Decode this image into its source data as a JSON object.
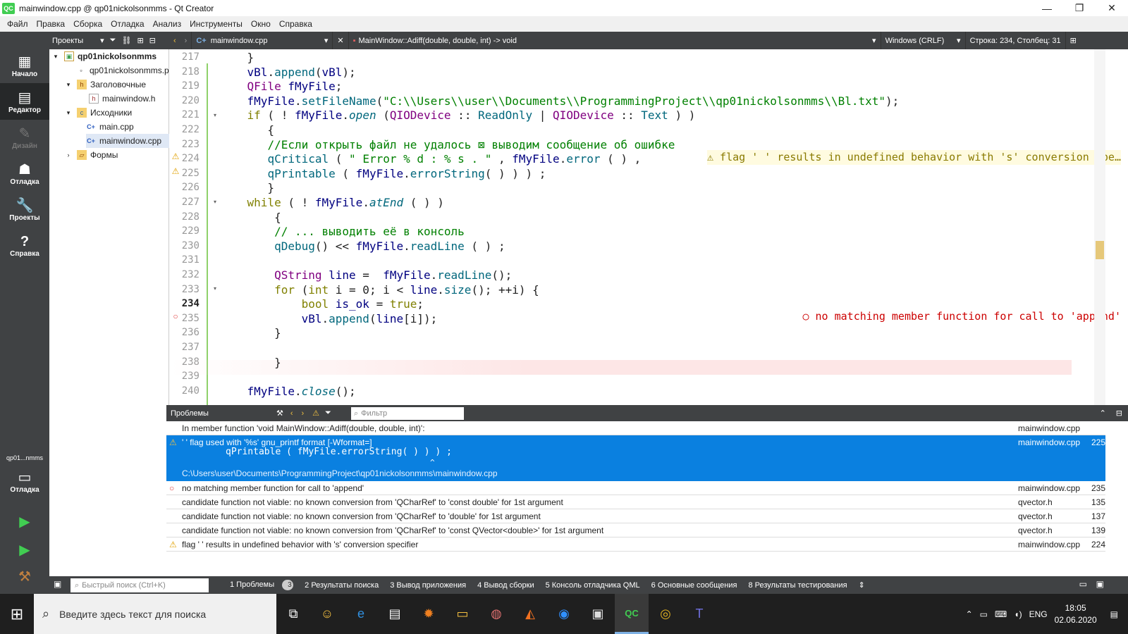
{
  "window": {
    "title": "mainwindow.cpp @ qp01nickolsonmms - Qt Creator",
    "logo": "QC"
  },
  "menu": [
    "Файл",
    "Правка",
    "Сборка",
    "Отладка",
    "Анализ",
    "Инструменты",
    "Окно",
    "Справка"
  ],
  "modes": [
    {
      "label": "Начало",
      "icon": "▦"
    },
    {
      "label": "Редактор",
      "icon": "▤"
    },
    {
      "label": "Дизайн",
      "icon": "✎"
    },
    {
      "label": "Отладка",
      "icon": "☗"
    },
    {
      "label": "Проекты",
      "icon": "🔧"
    },
    {
      "label": "Справка",
      "icon": "?"
    }
  ],
  "mode_project": {
    "label": "qp01...nmms",
    "run_label": "Отладка"
  },
  "proj_toolbar": {
    "label": "Проекты"
  },
  "editor_toolbar": {
    "file": "mainwindow.cpp",
    "symbol": "MainWindow::Adiff(double, double, int) -> void",
    "encoding": "Windows (CRLF)",
    "position": "Строка: 234, Столбец: 31"
  },
  "tree": [
    {
      "label": "qp01nickolsonmms",
      "arrow": "▾",
      "icon": "▣"
    },
    {
      "label": "qp01nickolsonmms.pro",
      "arrow": "",
      "icon": "▫"
    },
    {
      "label": "Заголовочные",
      "arrow": "▾",
      "icon": "h"
    },
    {
      "label": "mainwindow.h",
      "arrow": "",
      "icon": "h"
    },
    {
      "label": "Исходники",
      "arrow": "▾",
      "icon": "c"
    },
    {
      "label": "main.cpp",
      "arrow": "",
      "icon": "C+"
    },
    {
      "label": "mainwindow.cpp",
      "arrow": "",
      "icon": "C+"
    },
    {
      "label": "Формы",
      "arrow": "›",
      "icon": "▱"
    }
  ],
  "code_lines": [
    {
      "n": "217",
      "html": "    }"
    },
    {
      "n": "218",
      "html": "    vBl.append(vBl);"
    },
    {
      "n": "219",
      "html": "    QFile fMyFile;"
    },
    {
      "n": "220",
      "html": "    fMyFile.setFileName(\"C:\\\\Users\\\\user\\\\Documents\\\\ProgrammingProject\\\\qp01nickolsonmms\\\\Bl.txt\");"
    },
    {
      "n": "221",
      "html": "    if ( ! fMyFile.open (QIODevice :: ReadOnly | QIODevice :: Text ) )"
    },
    {
      "n": "222",
      "html": "       {"
    },
    {
      "n": "223",
      "html": "       //Если открыть файл не удалось ⊠ выводим сообщение об ошибке"
    },
    {
      "n": "224",
      "html": "       qCritical ( \" Error % d : % s . \" , fMyFile.error ( ) ,"
    },
    {
      "n": "225",
      "html": "       qPrintable ( fMyFile.errorString( ) ) ) ;"
    },
    {
      "n": "226",
      "html": "       }"
    },
    {
      "n": "227",
      "html": "    while ( ! fMyFile.atEnd ( ) )"
    },
    {
      "n": "228",
      "html": "        {"
    },
    {
      "n": "229",
      "html": "        // ... выводить её в консоль"
    },
    {
      "n": "230",
      "html": "        qDebug() << fMyFile.readLine ( ) ;"
    },
    {
      "n": "231",
      "html": ""
    },
    {
      "n": "232",
      "html": "        QString line =  fMyFile.readLine();"
    },
    {
      "n": "233",
      "html": "        for (int i = 0; i < line.size(); ++i) {"
    },
    {
      "n": "234",
      "html": "            bool is_ok = true;"
    },
    {
      "n": "235",
      "html": "            vBl.append(line[i]);"
    },
    {
      "n": "236",
      "html": "        }"
    },
    {
      "n": "237",
      "html": ""
    },
    {
      "n": "238",
      "html": "        }"
    },
    {
      "n": "239",
      "html": ""
    },
    {
      "n": "240",
      "html": "    fMyFile.close();"
    }
  ],
  "annotations": {
    "warn": "flag ' ' results in undefined behavior with 's' conversion spe…",
    "err": "no matching member function for call to 'append'"
  },
  "problems": {
    "title": "Проблемы",
    "filter_placeholder": "Фильтр",
    "rows": [
      {
        "icon": "",
        "text": "In member function 'void MainWindow::Adiff(double, double, int)':",
        "file": "mainwindow.cpp",
        "line": ""
      },
      {
        "icon": "⚠",
        "text": "' ' flag used with '%s' gnu_printf format [-Wformat=]",
        "file": "mainwindow.cpp",
        "line": "225",
        "code": "qPrintable ( fMyFile.errorString( ) ) ) ;",
        "caret": "^",
        "path": "C:\\Users\\user\\Documents\\ProgrammingProject\\qp01nickolsonmms\\mainwindow.cpp"
      },
      {
        "icon": "○",
        "text": "no matching member function for call to 'append'",
        "file": "mainwindow.cpp",
        "line": "235"
      },
      {
        "icon": "",
        "text": "candidate function not viable: no known conversion from 'QCharRef' to 'const double' for 1st argument",
        "file": "qvector.h",
        "line": "135"
      },
      {
        "icon": "",
        "text": "candidate function not viable: no known conversion from 'QCharRef' to 'double' for 1st argument",
        "file": "qvector.h",
        "line": "137"
      },
      {
        "icon": "",
        "text": "candidate function not viable: no known conversion from 'QCharRef' to 'const QVector<double>' for 1st argument",
        "file": "qvector.h",
        "line": "139"
      },
      {
        "icon": "⚠",
        "text": "flag ' ' results in undefined behavior with 's' conversion specifier",
        "file": "mainwindow.cpp",
        "line": "224"
      }
    ]
  },
  "output_bar": {
    "search_placeholder": "Быстрый поиск (Ctrl+K)",
    "tabs": [
      {
        "label": "1  Проблемы",
        "badge": "3"
      },
      {
        "label": "2  Результаты поиска"
      },
      {
        "label": "3  Вывод приложения"
      },
      {
        "label": "4  Вывод сборки"
      },
      {
        "label": "5  Консоль отладчика QML"
      },
      {
        "label": "6  Основные сообщения"
      },
      {
        "label": "8  Результаты тестирования"
      }
    ]
  },
  "taskbar": {
    "search_placeholder": "Введите здесь текст для поиска",
    "lang": "ENG",
    "time": "18:05",
    "date": "02.06.2020"
  }
}
